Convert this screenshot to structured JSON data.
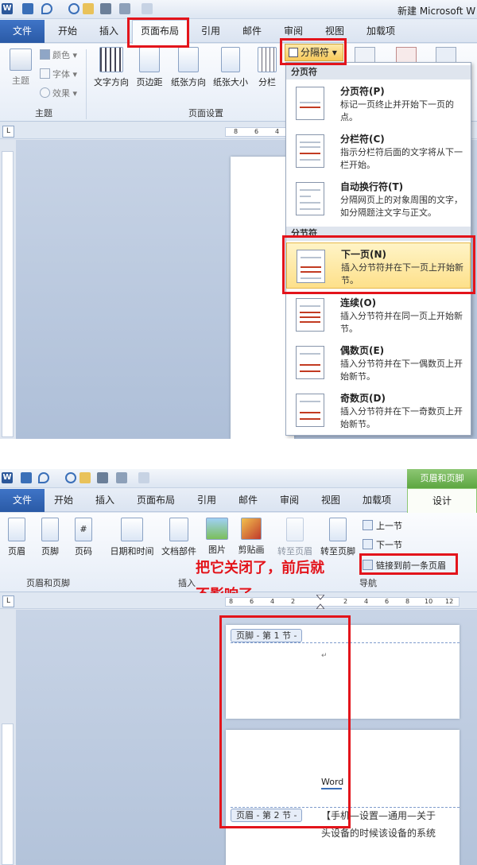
{
  "panel1": {
    "window_title": "新建 Microsoft W",
    "tabs": [
      "文件",
      "开始",
      "插入",
      "页面布局",
      "引用",
      "邮件",
      "审阅",
      "视图",
      "加载项"
    ],
    "theme_group": {
      "theme_label": "主题",
      "colors_label": "颜色",
      "fonts_label": "字体",
      "effects_label": "效果",
      "group_label": "主题"
    },
    "page_setup_group": {
      "text_direction_label": "文字方向",
      "margins_label": "页边距",
      "orientation_label": "纸张方向",
      "size_label": "纸张大小",
      "columns_label": "分栏",
      "group_label": "页面设置"
    },
    "breaks_button_label": "分隔符",
    "ruler_numbers": [
      "8",
      "6",
      "4"
    ],
    "breaks_menu": {
      "page_breaks_header": "分页符",
      "section_breaks_header": "分节符",
      "items": [
        {
          "title": "分页符(P)",
          "desc": "标记一页终止并开始下一页的点。"
        },
        {
          "title": "分栏符(C)",
          "desc": "指示分栏符后面的文字将从下一栏开始。"
        },
        {
          "title": "自动换行符(T)",
          "desc": "分隔网页上的对象周围的文字，如分隔题注文字与正文。"
        },
        {
          "title": "下一页(N)",
          "desc": "插入分节符并在下一页上开始新节。"
        },
        {
          "title": "连续(O)",
          "desc": "插入分节符并在同一页上开始新节。"
        },
        {
          "title": "偶数页(E)",
          "desc": "插入分节符并在下一偶数页上开始新节。"
        },
        {
          "title": "奇数页(D)",
          "desc": "插入分节符并在下一奇数页上开始新节。"
        }
      ]
    }
  },
  "panel2": {
    "context_tab_band": "页眉和页脚",
    "tabs": [
      "文件",
      "开始",
      "插入",
      "页面布局",
      "引用",
      "邮件",
      "审阅",
      "视图",
      "加载项",
      "设计"
    ],
    "header_footer_group": {
      "header_label": "页眉",
      "footer_label": "页脚",
      "page_number_label": "页码",
      "group_label": "页眉和页脚"
    },
    "insert_group": {
      "datetime_label": "日期和时间",
      "quickparts_label": "文档部件",
      "picture_label": "图片",
      "clipart_label": "剪贴画",
      "group_label": "插入"
    },
    "navigation_group": {
      "goto_header_label": "转至页眉",
      "goto_footer_label": "转至页脚",
      "previous_label": "上一节",
      "next_label": "下一节",
      "link_previous_label": "链接到前一条页眉",
      "group_label": "导航"
    },
    "annotation_line1": "把它关闭了，前后就",
    "annotation_line2": "不影响了",
    "ruler_numbers": [
      "8",
      "6",
      "4",
      "2",
      "2",
      "4",
      "6",
      "8",
      "10",
      "12"
    ],
    "footer_tag": "页脚 - 第 1 节 -",
    "header_tag": "页眉 - 第 2 节 -",
    "body_word": "Word",
    "tail_line1": "【手机—设置—通用—关于",
    "tail_line2": "头设备的时候该设备的系统"
  },
  "colors": {
    "accent_red": "#e3141b",
    "file_tab_blue": "#2f63b3",
    "context_green": "#6cb050"
  }
}
